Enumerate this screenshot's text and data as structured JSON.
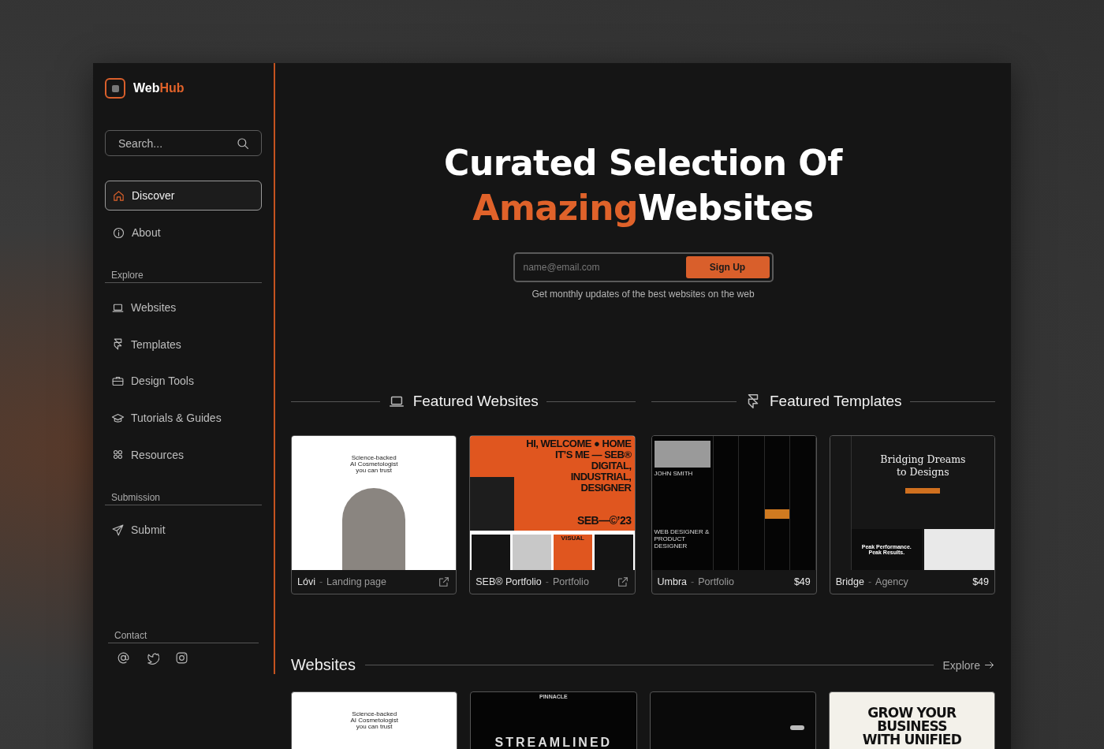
{
  "brand": {
    "parts": [
      {
        "text": "Web",
        "accent": false
      },
      {
        "text": "Hub",
        "accent": true
      }
    ]
  },
  "sidebar": {
    "search": {
      "placeholder": "Search..."
    },
    "nav": [
      {
        "label": "Discover",
        "selected": true
      },
      {
        "label": "About",
        "selected": false
      }
    ],
    "sections": [
      {
        "title": "Explore",
        "items": [
          {
            "label": "Websites"
          },
          {
            "label": "Templates"
          },
          {
            "label": "Design Tools"
          },
          {
            "label": "Tutorials & Guides"
          },
          {
            "label": "Resources"
          }
        ]
      },
      {
        "title": "Submission",
        "items": [
          {
            "label": "Submit"
          }
        ]
      }
    ],
    "contact": {
      "title": "Contact"
    }
  },
  "hero": {
    "lines": [
      [
        {
          "text": "Curated Selection Of",
          "accent": false
        }
      ],
      [
        {
          "text": "Amazing",
          "accent": true
        },
        {
          "text": "Websites",
          "accent": false
        }
      ]
    ],
    "email_placeholder": "name@email.com",
    "button": "Sign Up",
    "caption": "Get monthly updates of the best websites on the web"
  },
  "featured": [
    {
      "title": "Featured Websites",
      "cards": [
        {
          "name": "Lóvi",
          "separator": "-",
          "category": "Landing page",
          "preview": {
            "kind": "lovi",
            "texts": [
              "Science-backed",
              "AI Cosmetologist",
              "you can trust"
            ]
          }
        },
        {
          "name": "SEB® Portfolio",
          "separator": "-",
          "category": "Portfolio",
          "preview": {
            "kind": "seb",
            "texts": [
              "HI, WELCOME ● HOME",
              "IT’S ME — SEB®",
              "DIGITAL,",
              "INDUSTRIAL,",
              "DESIGNER",
              "SEB—©’23",
              "VISUAL"
            ]
          }
        }
      ]
    },
    {
      "title": "Featured Templates",
      "cards": [
        {
          "name": "Umbra",
          "separator": "-",
          "category": "Portfolio",
          "price": "$49",
          "preview": {
            "kind": "umbra",
            "texts": [
              "JOHN SMITH",
              "WEB DESIGNER & PRODUCT DESIGNER"
            ]
          }
        },
        {
          "name": "Bridge",
          "separator": "-",
          "category": "Agency",
          "price": "$49",
          "preview": {
            "kind": "bridge",
            "texts": [
              "Bridging Dreams",
              "to Designs",
              "Peak Performance.",
              "Peak Results."
            ]
          }
        }
      ]
    }
  ],
  "websites": {
    "title": "Websites",
    "link": "Explore",
    "cards": [
      {
        "preview": {
          "kind": "lovi",
          "texts": [
            "Science-backed",
            "AI Cosmetologist",
            "you can trust"
          ]
        }
      },
      {
        "preview": {
          "kind": "pinnacle",
          "texts": [
            "PINNACLE",
            "STREAMLINED"
          ]
        }
      },
      {
        "preview": {
          "kind": "dark"
        }
      },
      {
        "preview": {
          "kind": "grow",
          "texts": [
            "GROW YOUR",
            "BUSINESS",
            "WITH UNIFIED"
          ]
        }
      }
    ]
  }
}
